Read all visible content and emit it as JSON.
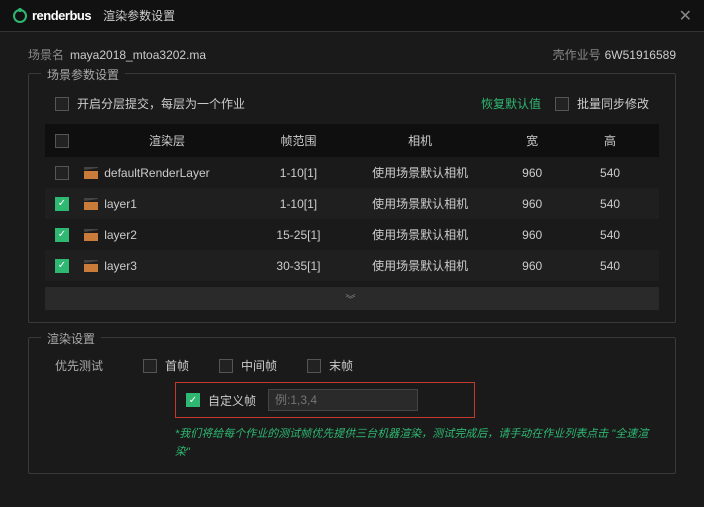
{
  "titlebar": {
    "brand": "renderbus",
    "title": "渲染参数设置"
  },
  "header": {
    "scene_label": "场景名",
    "scene_value": "maya2018_mtoa3202.ma",
    "job_label": "壳作业号",
    "job_value": "6W51916589"
  },
  "scene_panel": {
    "title": "场景参数设置",
    "layer_submit": "开启分层提交，每层为一个作业",
    "restore_defaults": "恢复默认值",
    "batch_sync": "批量同步修改",
    "columns": {
      "layer": "渲染层",
      "range": "帧范围",
      "camera": "相机",
      "width": "宽",
      "height": "高"
    },
    "rows": [
      {
        "checked": false,
        "name": "defaultRenderLayer",
        "range": "1-10[1]",
        "camera": "使用场景默认相机",
        "width": "960",
        "height": "540"
      },
      {
        "checked": true,
        "name": "layer1",
        "range": "1-10[1]",
        "camera": "使用场景默认相机",
        "width": "960",
        "height": "540"
      },
      {
        "checked": true,
        "name": "layer2",
        "range": "15-25[1]",
        "camera": "使用场景默认相机",
        "width": "960",
        "height": "540"
      },
      {
        "checked": true,
        "name": "layer3",
        "range": "30-35[1]",
        "camera": "使用场景默认相机",
        "width": "960",
        "height": "540"
      }
    ]
  },
  "render_panel": {
    "title": "渲染设置",
    "priority_label": "优先测试",
    "first_frame": "首帧",
    "mid_frame": "中间帧",
    "last_frame": "末帧",
    "custom_frame": "自定义帧",
    "custom_placeholder": "例:1,3,4",
    "hint": "*我们将给每个作业的测试帧优先提供三台机器渲染，测试完成后，请手动在作业列表点击 \"全速渲染\""
  }
}
